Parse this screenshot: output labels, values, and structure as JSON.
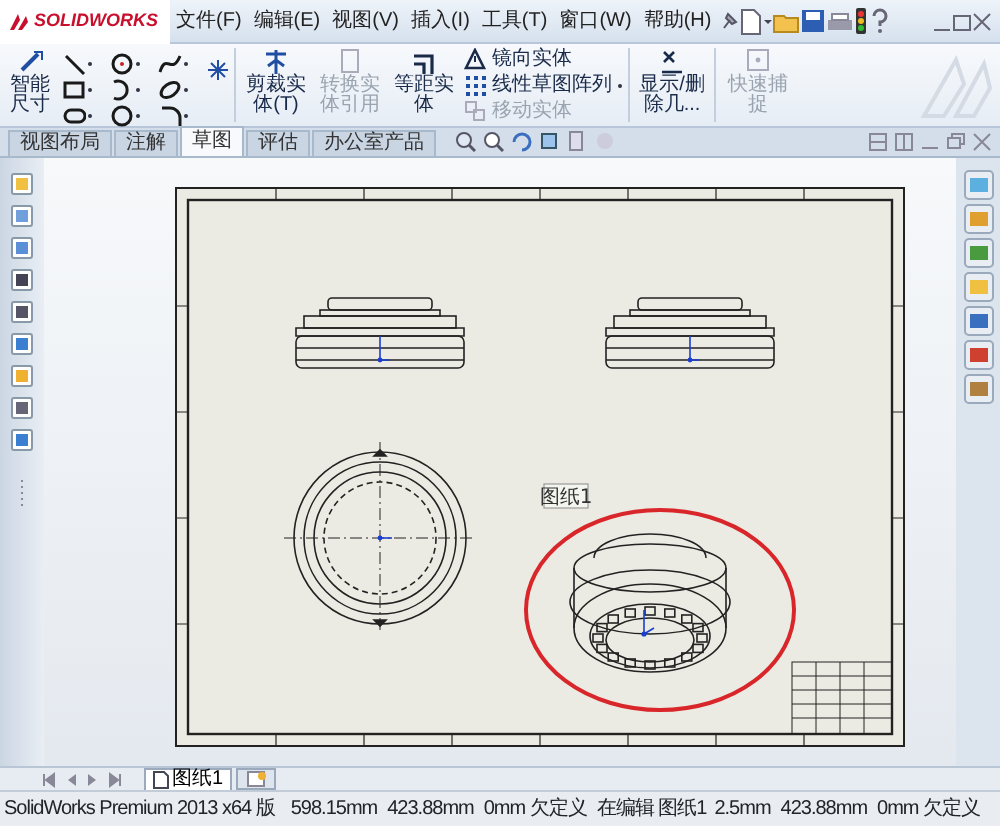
{
  "app": {
    "logo": "SOLIDWORKS"
  },
  "menu": [
    "文件(F)",
    "编辑(E)",
    "视图(V)",
    "插入(I)",
    "工具(T)",
    "窗口(W)",
    "帮助(H)"
  ],
  "ribbon": {
    "smart_dimension": "智能尺寸",
    "tools": [
      {
        "label": "剪裁实体(T)",
        "disabled": false
      },
      {
        "label": "转换实体引用",
        "disabled": true
      },
      {
        "label": "等距实体",
        "disabled": false
      }
    ],
    "list_tools": [
      {
        "label": "镜向实体",
        "disabled": false
      },
      {
        "label": "线性草图阵列",
        "disabled": false
      },
      {
        "label": "移动实体",
        "disabled": true
      }
    ],
    "more": [
      {
        "label": "显示/删除几...",
        "disabled": false
      },
      {
        "label": "快速捕捉",
        "disabled": true
      }
    ]
  },
  "tabs": [
    {
      "label": "视图布局",
      "selected": false
    },
    {
      "label": "注解",
      "selected": false
    },
    {
      "label": "草图",
      "selected": true
    },
    {
      "label": "评估",
      "selected": false
    },
    {
      "label": "办公室产品",
      "selected": false
    }
  ],
  "drawing": {
    "sheet_label": "图纸1"
  },
  "sheet_tabs": [
    {
      "label": "图纸1",
      "selected": true
    }
  ],
  "status_bar": [
    "SolidWorks Premium 2013 x64 版",
    "598.15mm",
    "423.88mm",
    "0mm 欠定义",
    "在编辑 图纸1",
    "2.5mm",
    "423.88mm",
    "0mm 欠定义"
  ]
}
